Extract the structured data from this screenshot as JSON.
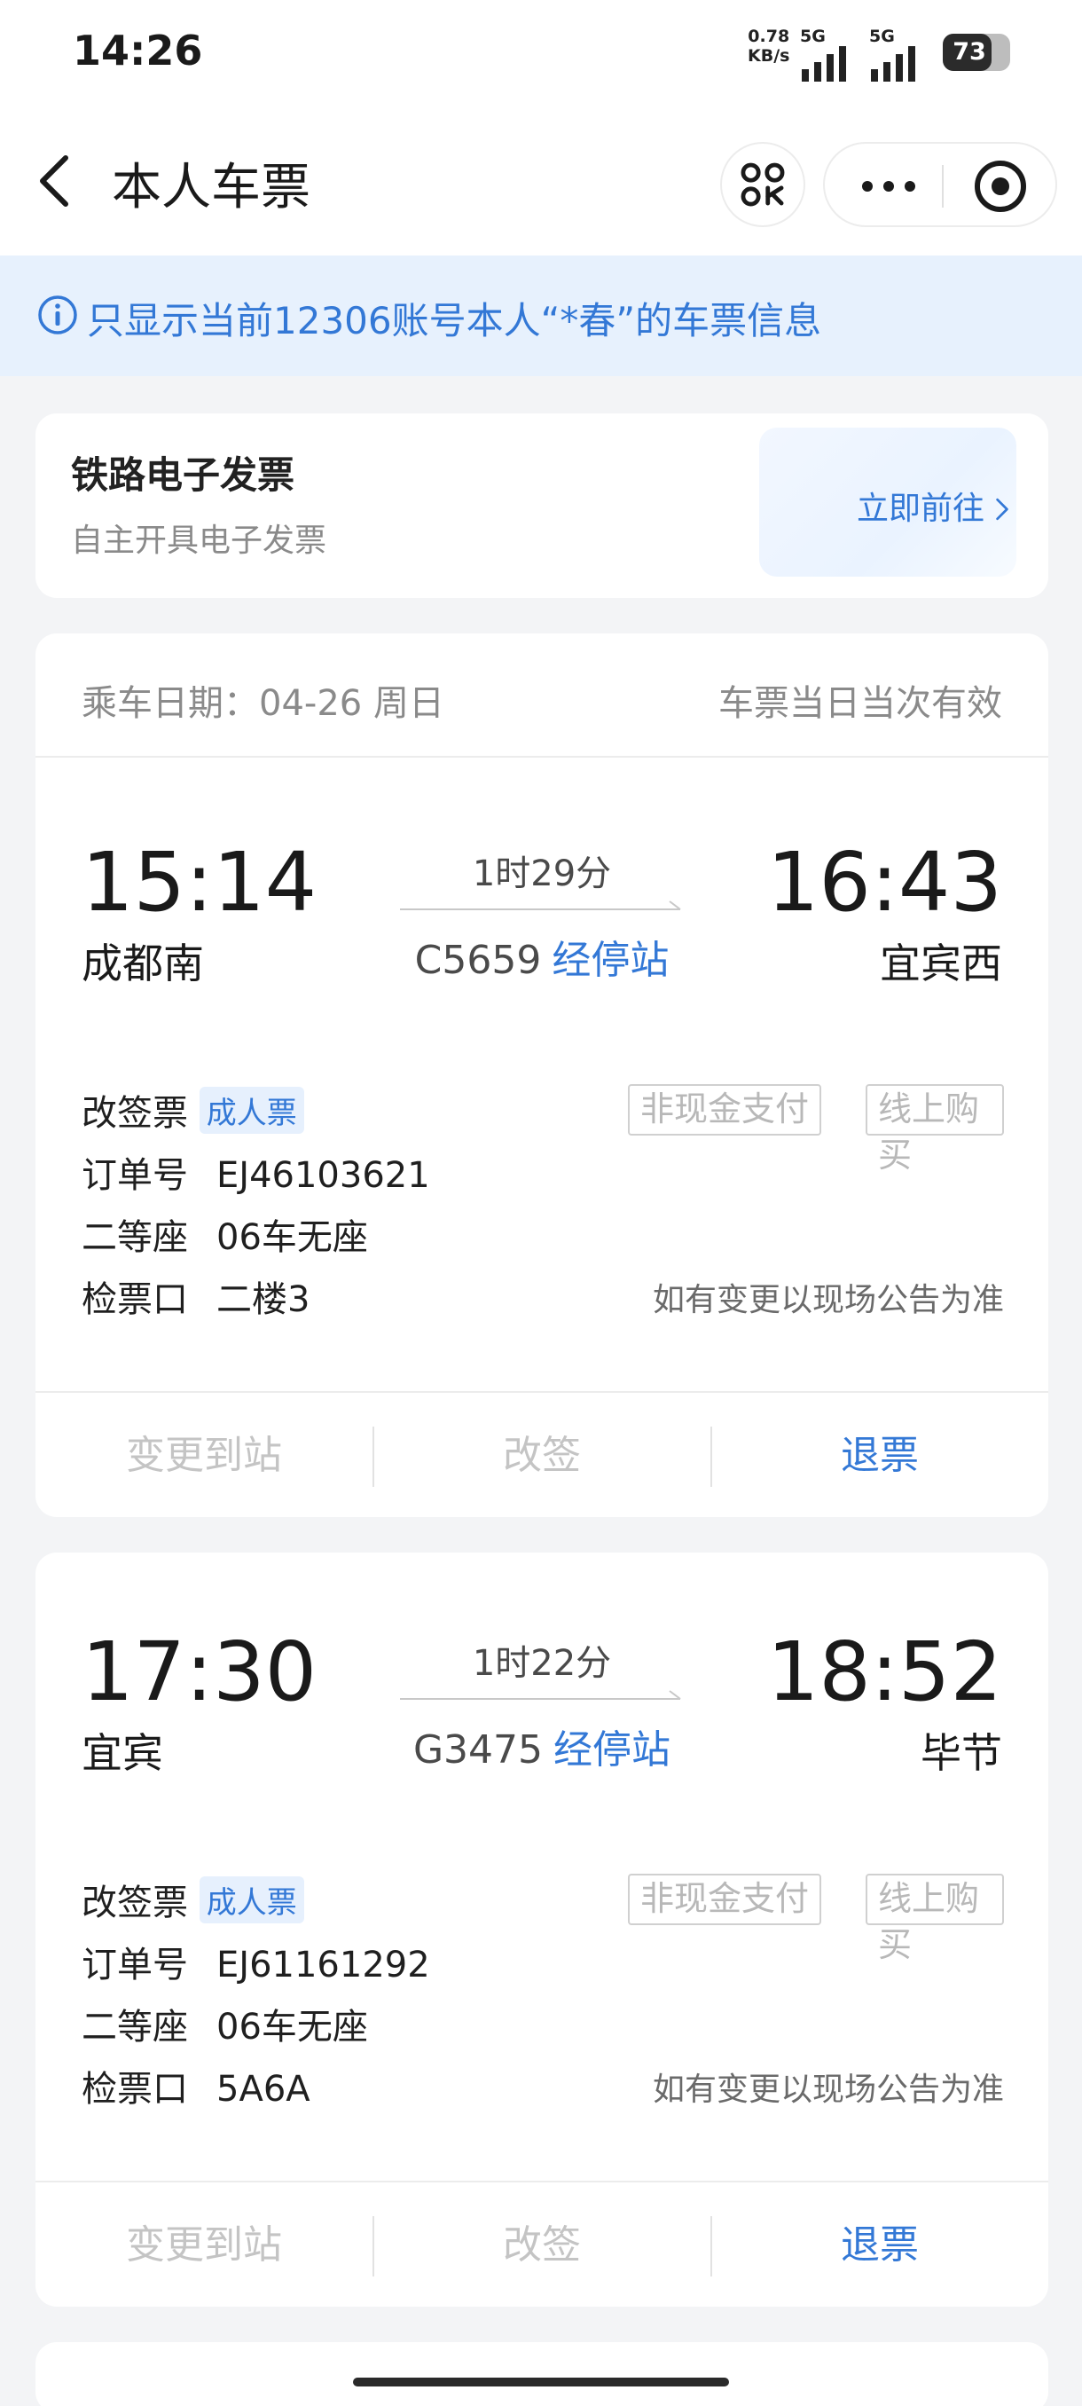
{
  "status_bar": {
    "time": "14:26",
    "net_speed_value": "0.78",
    "net_speed_unit": "KB/s",
    "signal1": "5G",
    "signal2": "5G",
    "battery": "73",
    "battery_level": 0.73
  },
  "nav": {
    "title": "本人车票"
  },
  "notice": {
    "text": "只显示当前12306账号本人“*春”的车票信息"
  },
  "invoice": {
    "title": "铁路电子发票",
    "subtitle": "自主开具电子发票",
    "link": "立即前往"
  },
  "tickets": [
    {
      "date_label": "乘车日期：04-26 周日",
      "validity": "车票当日当次有效",
      "dep_time": "15:14",
      "dep_station": "成都南",
      "arr_time": "16:43",
      "arr_station": "宜宾西",
      "duration": "1时29分",
      "train_no": "C5659",
      "stops_link": "经停站",
      "ticket_type_label": "改签票",
      "passenger_type": "成人票",
      "tag1": "非现金支付",
      "tag2": "线上购买",
      "order_label": "订单号",
      "order_no": "EJ46103621",
      "seat_class": "二等座",
      "seat": "06车无座",
      "gate_label": "检票口",
      "gate": "二楼3",
      "gate_note": "如有变更以现场公告为准",
      "action_change_station": "变更到站",
      "action_reschedule": "改签",
      "action_refund": "退票"
    },
    {
      "dep_time": "17:30",
      "dep_station": "宜宾",
      "arr_time": "18:52",
      "arr_station": "毕节",
      "duration": "1时22分",
      "train_no": "G3475",
      "stops_link": "经停站",
      "ticket_type_label": "改签票",
      "passenger_type": "成人票",
      "tag1": "非现金支付",
      "tag2": "线上购买",
      "order_label": "订单号",
      "order_no": "EJ61161292",
      "seat_class": "二等座",
      "seat": "06车无座",
      "gate_label": "检票口",
      "gate": "5A6A",
      "gate_note": "如有变更以现场公告为准",
      "action_change_station": "变更到站",
      "action_reschedule": "改签",
      "action_refund": "退票"
    }
  ],
  "colors": {
    "accent": "#3378d6",
    "notice_bg": "#e7f1fd",
    "page_bg": "#f3f4f6",
    "disabled": "#c4c4c4"
  },
  "icons": [
    "back-arrow-icon",
    "scan-icon",
    "more-icon",
    "target-icon",
    "info-icon",
    "chevron-right-icon",
    "arrow-right-icon"
  ]
}
